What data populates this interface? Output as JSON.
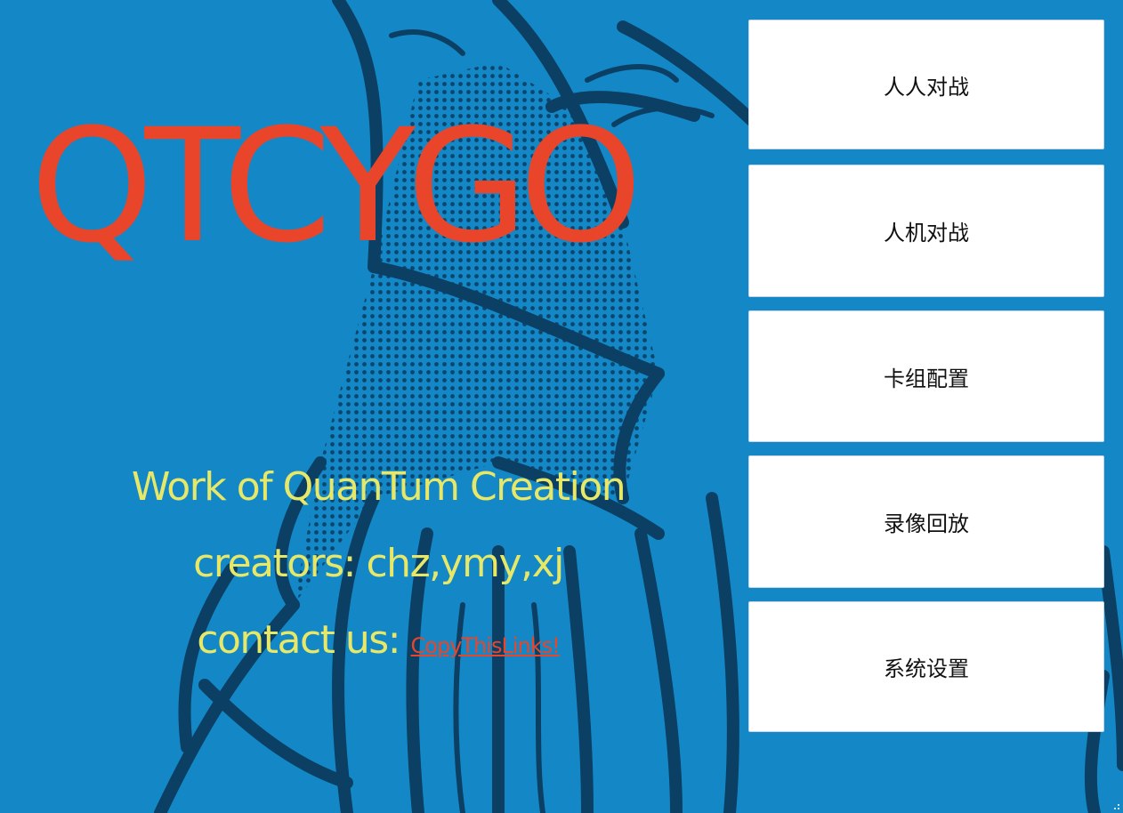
{
  "colors": {
    "background": "#1488c6",
    "line_art": "#0b3f63",
    "title": "#e8452a",
    "credits": "#e8e868",
    "link": "#e8452a",
    "button_bg": "#ffffff",
    "button_text": "#111111"
  },
  "title": "QTCYGO",
  "credits": {
    "work_line": "Work of QuanTum Creation",
    "creators_line": "creators: chz,ymy,xj",
    "contact_label": "contact us:",
    "contact_link": "CopyThisLinks!"
  },
  "menu": {
    "pvp": "人人对战",
    "pve": "人机对战",
    "deck": "卡组配置",
    "replay": "录像回放",
    "settings": "系统设置"
  }
}
